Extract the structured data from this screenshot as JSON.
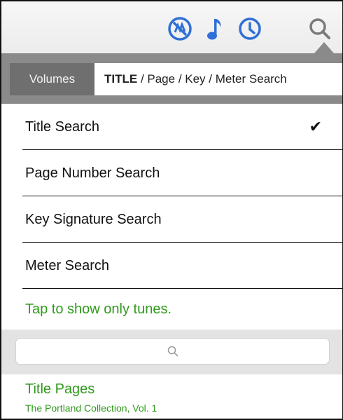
{
  "toolbar": {
    "icons": [
      "no-midi-icon",
      "music-note-icon",
      "clock-icon",
      "search-icon"
    ],
    "accent_color": "#2f6fd8"
  },
  "tabs": {
    "volumes_label": "Volumes",
    "search_bold": "TITLE",
    "search_rest": " / Page / Key / Meter Search"
  },
  "search_modes": [
    {
      "label": "Title Search",
      "checked": true
    },
    {
      "label": "Page Number Search",
      "checked": false
    },
    {
      "label": "Key Signature Search",
      "checked": false
    },
    {
      "label": "Meter Search",
      "checked": false
    }
  ],
  "checkmark": "✔",
  "tap_hint": "Tap to show only tunes.",
  "search": {
    "value": "",
    "placeholder": ""
  },
  "result": {
    "title": "Title Pages",
    "subtitle": "The Portland Collection, Vol. 1",
    "color": "#2f9a1b"
  }
}
